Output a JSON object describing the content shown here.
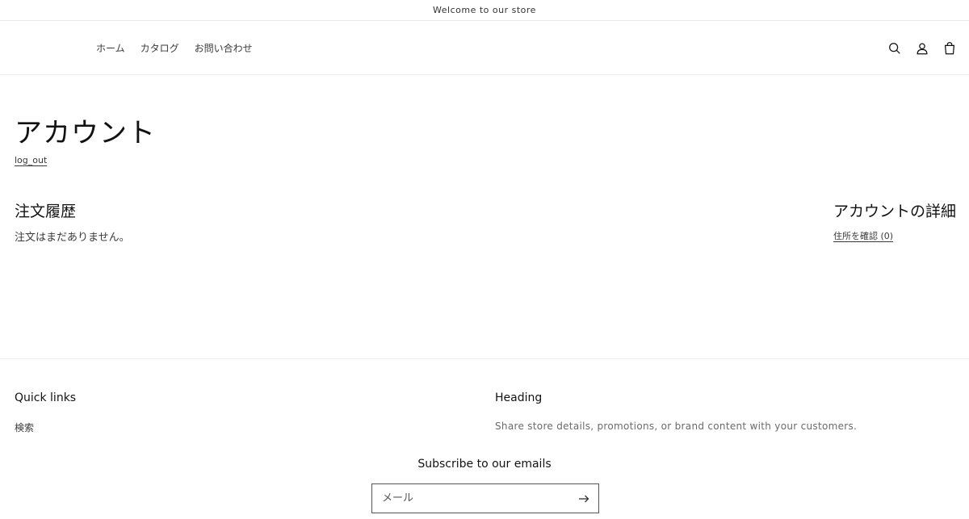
{
  "announcement": {
    "text": "Welcome to our store"
  },
  "header": {
    "nav": [
      {
        "label": "ホーム"
      },
      {
        "label": "カタログ"
      },
      {
        "label": "お問い合わせ"
      }
    ],
    "icons": [
      "search-icon",
      "account-icon",
      "cart-icon"
    ]
  },
  "account": {
    "title": "アカウント",
    "logout_label": "log_out"
  },
  "orders": {
    "title": "注文履歴",
    "empty_text": "注文はまだありません。"
  },
  "details": {
    "title": "アカウントの詳細",
    "addresses_label": "住所を確認",
    "addresses_count": "(0)"
  },
  "footer": {
    "quick_links": {
      "title": "Quick links",
      "items": [
        {
          "label": "検索"
        }
      ]
    },
    "heading": {
      "title": "Heading",
      "text": "Share store details, promotions, or brand content with your customers."
    },
    "subscribe": {
      "title": "Subscribe to our emails",
      "placeholder": "メール"
    }
  }
}
